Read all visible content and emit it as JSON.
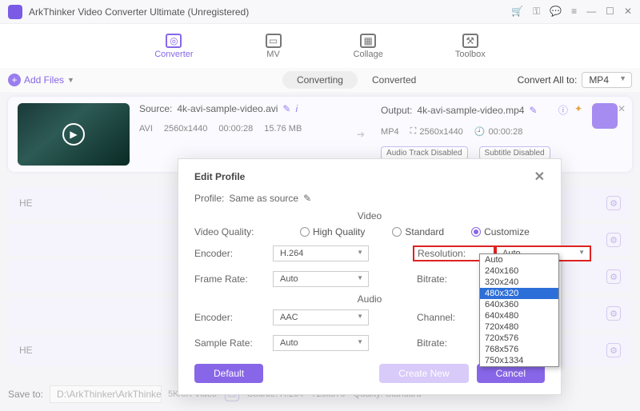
{
  "titlebar": {
    "title": "ArkThinker Video Converter Ultimate (Unregistered)"
  },
  "mainTabs": {
    "converter": "Converter",
    "mv": "MV",
    "collage": "Collage",
    "toolbox": "Toolbox"
  },
  "toolbar": {
    "addFiles": "Add Files",
    "converting": "Converting",
    "converted": "Converted",
    "convertAll": "Convert All to:",
    "format": "MP4"
  },
  "file": {
    "sourceLbl": "Source:",
    "sourceName": "4k-avi-sample-video.avi",
    "srcFmt": "AVI",
    "srcRes": "2560x1440",
    "srcDur": "00:00:28",
    "srcSize": "15.76 MB",
    "outputLbl": "Output:",
    "outputName": "4k-avi-sample-video.mp4",
    "outFmt": "MP4",
    "outRes": "2560x1440",
    "outDur": "00:00:28",
    "audioTrack": "Audio Track Disabled",
    "subtitle": "Subtitle Disabled"
  },
  "ghost": {
    "he1": "HE",
    "he2": "HE",
    "label58": "5K/8K Video",
    "srcLine": "Source:  H.264",
    "res": "720x576",
    "q": "Quality: Standard"
  },
  "footer": {
    "saveTo": "Save to:",
    "path": "D:\\ArkThinker\\ArkThinke"
  },
  "modal": {
    "title": "Edit Profile",
    "profileLbl": "Profile:",
    "profileVal": "Same as source",
    "videoHdr": "Video",
    "audioHdr": "Audio",
    "qualityLbl": "Video Quality:",
    "high": "High Quality",
    "standard": "Standard",
    "customize": "Customize",
    "encoderLbl": "Encoder:",
    "encoderVal": "H.264",
    "frameRateLbl": "Frame Rate:",
    "frameRateVal": "Auto",
    "resolutionLbl": "Resolution:",
    "resolutionVal": "Auto",
    "bitrateLbl": "Bitrate:",
    "aEncoderVal": "AAC",
    "sampleRateLbl": "Sample Rate:",
    "sampleRateVal": "Auto",
    "channelLbl": "Channel:",
    "defaultBtn": "Default",
    "createBtn": "Create New",
    "cancelBtn": "Cancel"
  },
  "resOptions": [
    "Auto",
    "240x160",
    "320x240",
    "480x320",
    "640x360",
    "640x480",
    "720x480",
    "720x576",
    "768x576",
    "750x1334"
  ],
  "resSelected": "480x320"
}
